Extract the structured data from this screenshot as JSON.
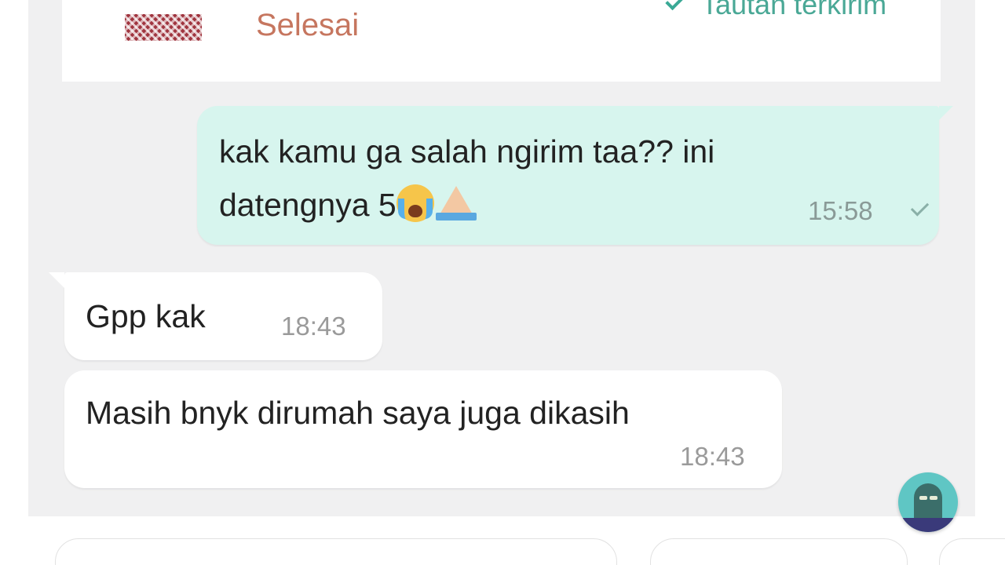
{
  "order_card": {
    "status": "Selesai",
    "link_status": "Tautan terkirim"
  },
  "messages": [
    {
      "direction": "outgoing",
      "text": "kak kamu ga salah ngirim taa?? ini\ndatengnya 5",
      "emojis": [
        "loudly-crying-face",
        "folded-hands"
      ],
      "time": "15:58",
      "status_icon": "sent-check-icon"
    },
    {
      "direction": "incoming",
      "text": "Gpp kak",
      "time": "18:43"
    },
    {
      "direction": "incoming",
      "text": "Masih bnyk dirumah saya juga dikasih",
      "time": "18:43"
    }
  ],
  "colors": {
    "chat_background": "#f0f0f1",
    "outgoing_bubble": "#d7f5ee",
    "incoming_bubble": "#ffffff",
    "status_text": "#c6765f",
    "link_accent": "#3aa996"
  }
}
